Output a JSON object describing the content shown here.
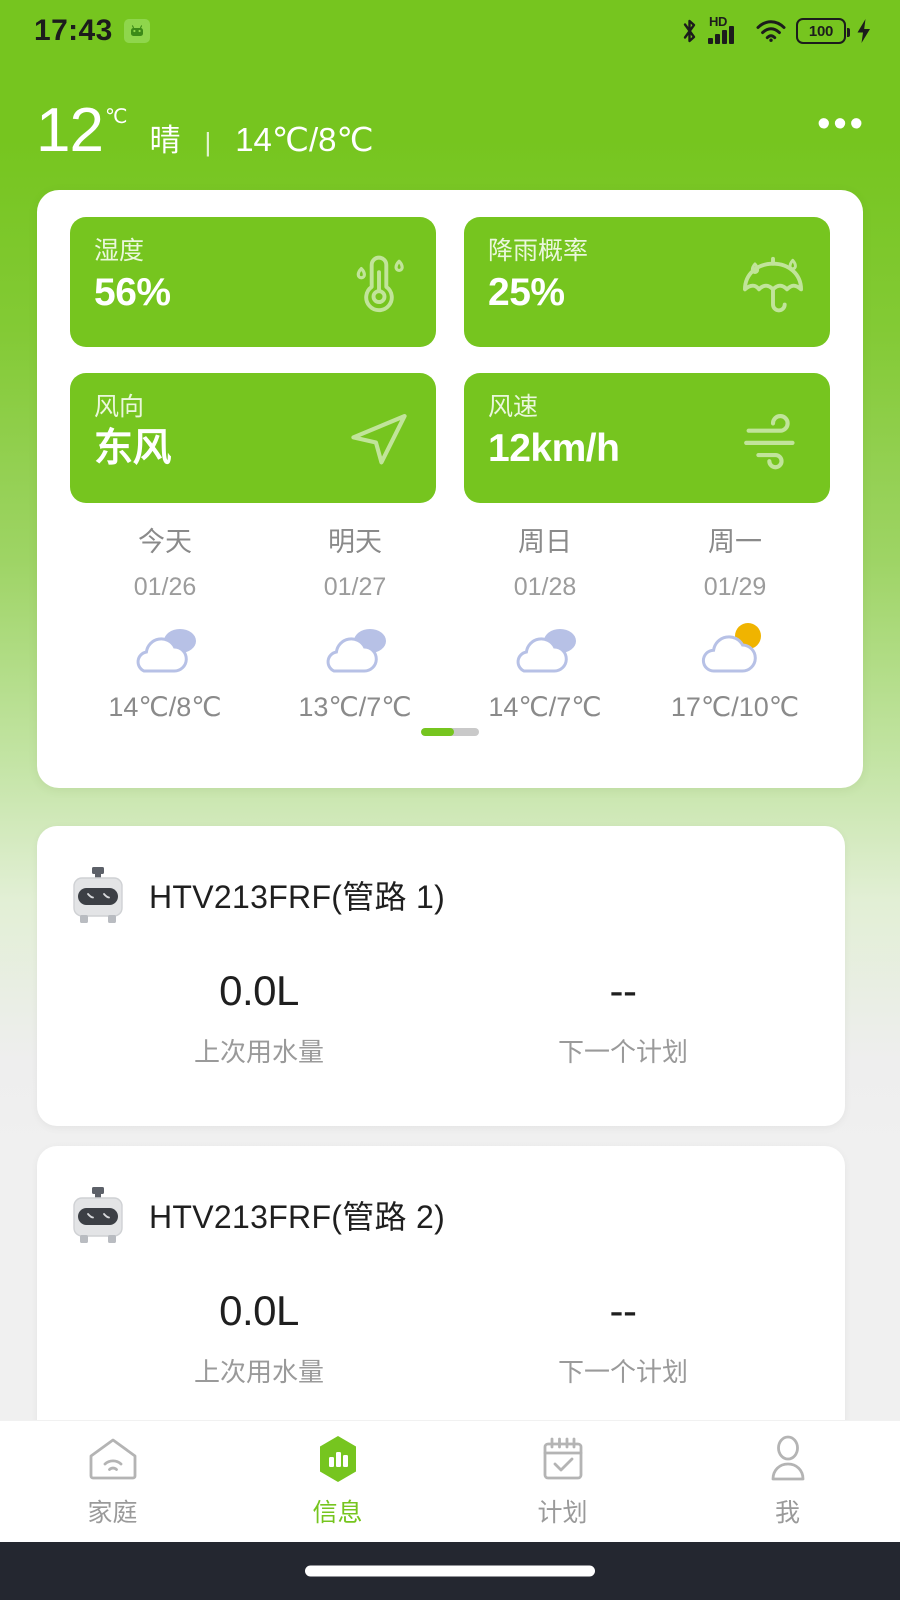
{
  "statusbar": {
    "time": "17:43",
    "battery_percent": "100",
    "icons": [
      "android-icon",
      "bluetooth-icon",
      "hd-icon",
      "signal-bars-icon",
      "wifi-icon",
      "battery-icon",
      "charging-bolt-icon"
    ]
  },
  "header": {
    "temperature": "12",
    "unit": "℃",
    "condition": "晴",
    "separator": "|",
    "range": "14℃/8℃",
    "more_label": "•••"
  },
  "metrics": [
    {
      "label": "湿度",
      "value": "56%",
      "icon": "thermometer-humidity-icon"
    },
    {
      "label": "降雨概率",
      "value": "25%",
      "icon": "umbrella-icon"
    },
    {
      "label": "风向",
      "value": "东风",
      "icon": "navigation-arrow-icon"
    },
    {
      "label": "风速",
      "value": "12km/h",
      "icon": "wind-icon"
    }
  ],
  "forecast": [
    {
      "day": "今天",
      "date": "01/26",
      "icon": "cloudy-icon",
      "temp": "14℃/8℃"
    },
    {
      "day": "明天",
      "date": "01/27",
      "icon": "cloudy-icon",
      "temp": "13℃/7℃"
    },
    {
      "day": "周日",
      "date": "01/28",
      "icon": "cloudy-icon",
      "temp": "14℃/7℃"
    },
    {
      "day": "周一",
      "date": "01/29",
      "icon": "partly-sunny-icon",
      "temp": "17℃/10℃"
    }
  ],
  "devices": [
    {
      "name": "HTV213FRF(管路 1)",
      "icon": "valve-controller-icon",
      "stats": [
        {
          "value": "0.0L",
          "label": "上次用水量"
        },
        {
          "value": "--",
          "label": "下一个计划"
        }
      ]
    },
    {
      "name": "HTV213FRF(管路 2)",
      "icon": "valve-controller-icon",
      "stats": [
        {
          "value": "0.0L",
          "label": "上次用水量"
        },
        {
          "value": "--",
          "label": "下一个计划"
        }
      ]
    }
  ],
  "bottom_nav": [
    {
      "label": "家庭",
      "icon": "home-wifi-icon",
      "active": false
    },
    {
      "label": "信息",
      "icon": "info-chart-icon",
      "active": true
    },
    {
      "label": "计划",
      "icon": "calendar-check-icon",
      "active": false
    },
    {
      "label": "我",
      "icon": "person-icon",
      "active": false
    }
  ],
  "colors": {
    "brand_green": "#76c51f",
    "card_white": "#ffffff",
    "muted_text": "#9a9a9a",
    "sun_yellow": "#f0b400",
    "cloud_blue": "#b9c2e8"
  }
}
